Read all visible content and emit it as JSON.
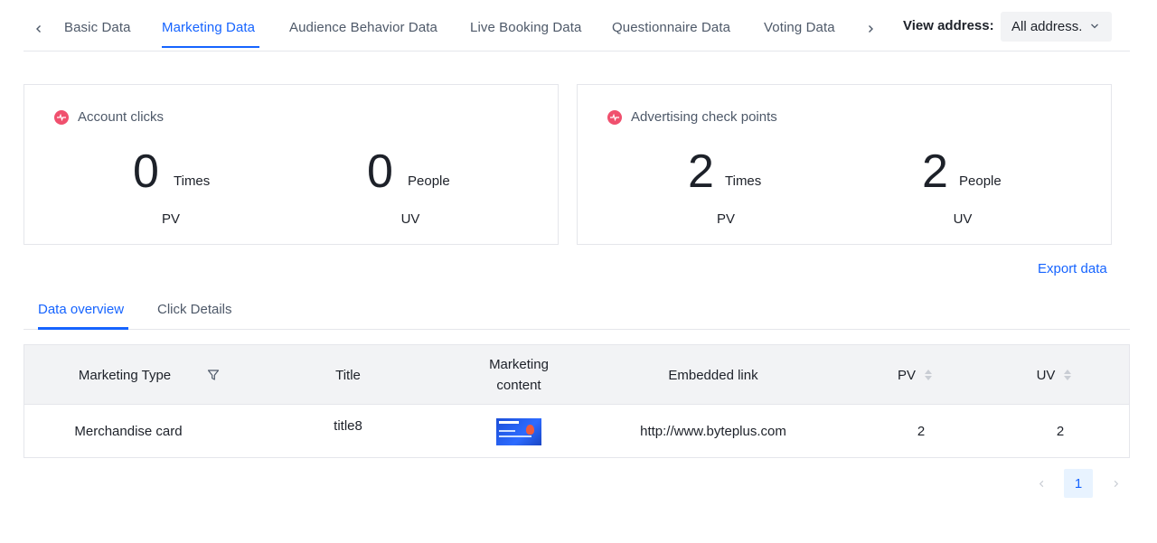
{
  "tabs": {
    "items": [
      {
        "label": "Basic Data"
      },
      {
        "label": "Marketing Data"
      },
      {
        "label": "Audience Behavior Data"
      },
      {
        "label": "Live Booking Data"
      },
      {
        "label": "Questionnaire Data"
      },
      {
        "label": "Voting Data"
      }
    ],
    "active_index": 1
  },
  "view_address": {
    "label": "View address:",
    "selected": "All address."
  },
  "cards": [
    {
      "title": "Account clicks",
      "metrics": [
        {
          "value": "0",
          "unit": "Times",
          "label": "PV"
        },
        {
          "value": "0",
          "unit": "People",
          "label": "UV"
        }
      ]
    },
    {
      "title": "Advertising check points",
      "metrics": [
        {
          "value": "2",
          "unit": "Times",
          "label": "PV"
        },
        {
          "value": "2",
          "unit": "People",
          "label": "UV"
        }
      ]
    }
  ],
  "export_label": "Export data",
  "subtabs": {
    "items": [
      {
        "label": "Data overview"
      },
      {
        "label": "Click Details"
      }
    ],
    "active_index": 0
  },
  "table": {
    "columns": [
      {
        "label": "Marketing Type"
      },
      {
        "label": "Title"
      },
      {
        "label": "Marketing content"
      },
      {
        "label": "Embedded link"
      },
      {
        "label": "PV"
      },
      {
        "label": "UV"
      }
    ],
    "rows": [
      {
        "type": "Merchandise card",
        "title": "title8",
        "content_image": "byteplus-banner-thumbnail",
        "link": "http://www.byteplus.com",
        "pv": "2",
        "uv": "2"
      }
    ]
  },
  "pagination": {
    "current": "1"
  },
  "colors": {
    "accent": "#1664ff",
    "pulse_icon": "#f0506e",
    "header_bg": "#f2f3f5"
  }
}
